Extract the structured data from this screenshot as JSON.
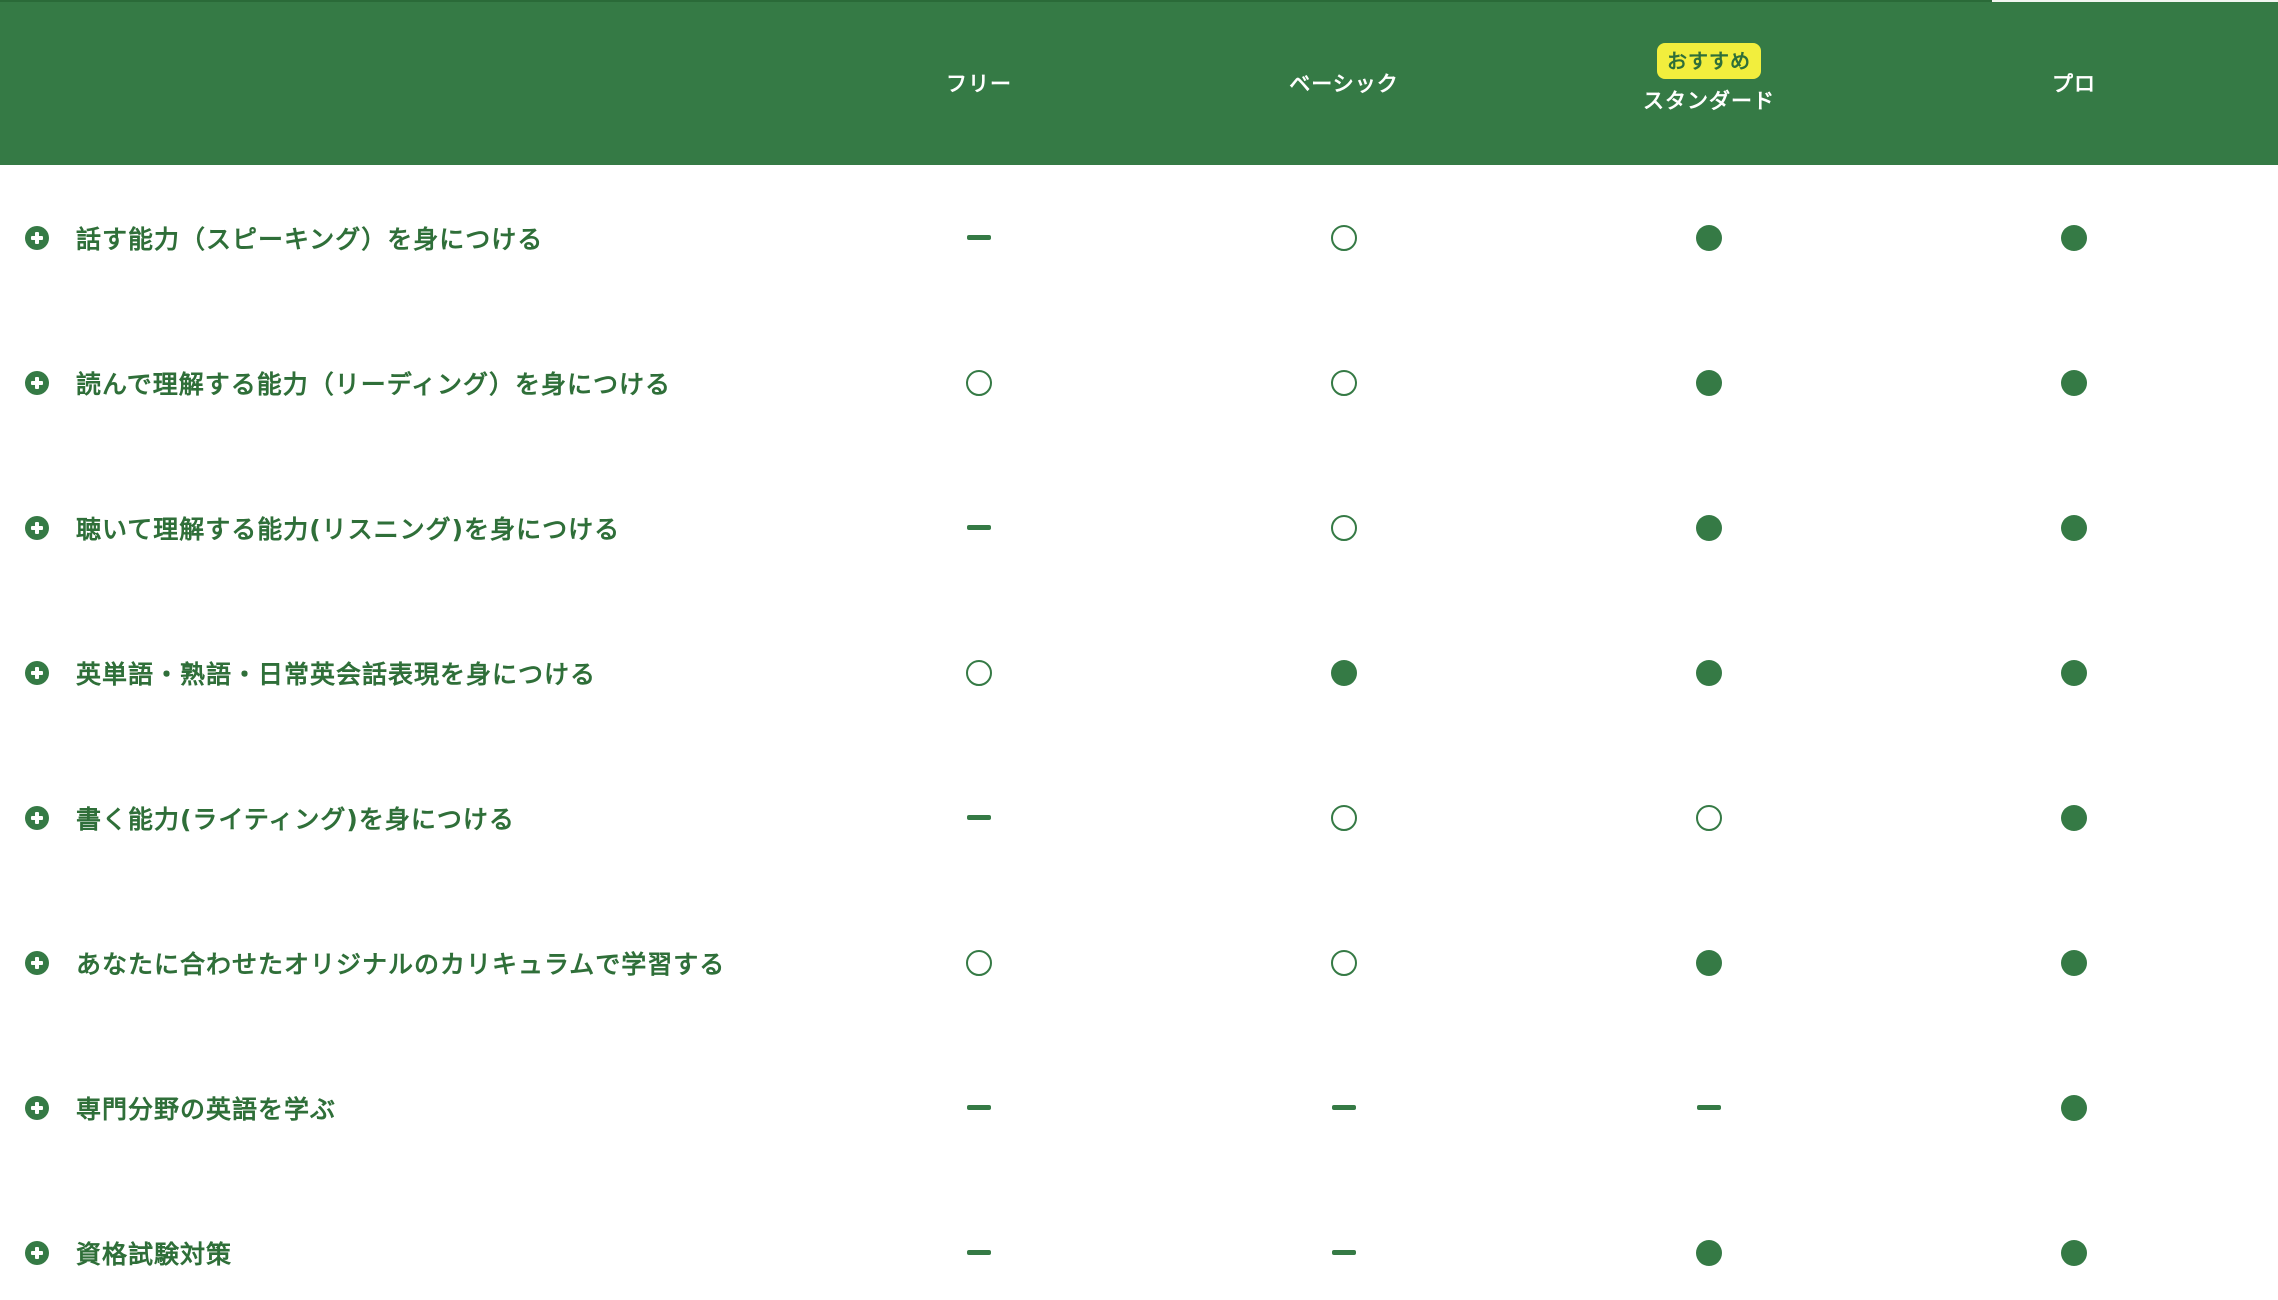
{
  "plans": [
    {
      "label": "フリー",
      "badge": ""
    },
    {
      "label": "ベーシック",
      "badge": ""
    },
    {
      "label": "スタンダード",
      "badge": "おすすめ"
    },
    {
      "label": "プロ",
      "badge": ""
    }
  ],
  "legend": {
    "none": "－",
    "partial": "○",
    "full": "●"
  },
  "features": [
    {
      "label": "話す能力（スピーキング）を身につける",
      "marks": [
        "none",
        "partial",
        "full",
        "full"
      ]
    },
    {
      "label": "読んで理解する能力（リーディング）を身につける",
      "marks": [
        "partial",
        "partial",
        "full",
        "full"
      ]
    },
    {
      "label": "聴いて理解する能力(リスニング)を身につける",
      "marks": [
        "none",
        "partial",
        "full",
        "full"
      ]
    },
    {
      "label": "英単語・熟語・日常英会話表現を身につける",
      "marks": [
        "partial",
        "full",
        "full",
        "full"
      ]
    },
    {
      "label": "書く能力(ライティング)を身につける",
      "marks": [
        "none",
        "partial",
        "partial",
        "full"
      ]
    },
    {
      "label": "あなたに合わせたオリジナルのカリキュラムで学習する",
      "marks": [
        "partial",
        "partial",
        "full",
        "full"
      ]
    },
    {
      "label": "専門分野の英語を学ぶ",
      "marks": [
        "none",
        "none",
        "none",
        "full"
      ]
    },
    {
      "label": "資格試験対策",
      "marks": [
        "none",
        "none",
        "full",
        "full"
      ]
    }
  ],
  "colors": {
    "header_bg": "#357a45",
    "text_green": "#2f6f39",
    "badge_bg": "#f2ee3d"
  },
  "icons": {
    "expand": "plus-circle-icon"
  }
}
